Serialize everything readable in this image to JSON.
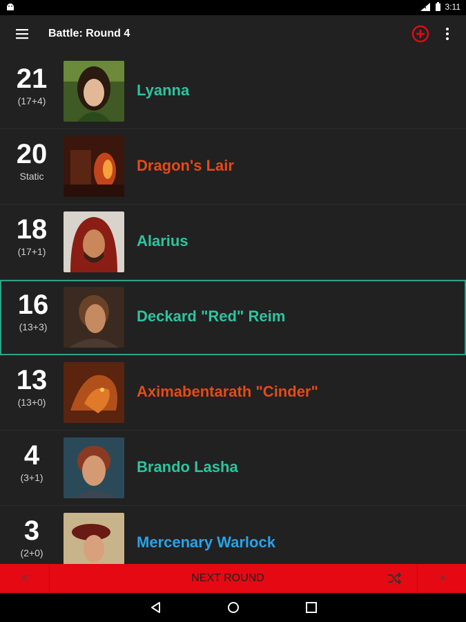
{
  "status_bar": {
    "time": "3:11"
  },
  "app_bar": {
    "title": "Battle: Round 4"
  },
  "colors": {
    "player": "#2ec4a0",
    "enemy": "#e64a19",
    "ally": "#29a3e8",
    "accent_red": "#e50914",
    "active_border": "#2ea38a"
  },
  "combatants": [
    {
      "initiative": "21",
      "detail": "(17+4)",
      "name": "Lyanna",
      "type": "player"
    },
    {
      "initiative": "20",
      "detail": "Static",
      "name": "Dragon's Lair",
      "type": "enemy"
    },
    {
      "initiative": "18",
      "detail": "(17+1)",
      "name": "Alarius",
      "type": "player"
    },
    {
      "initiative": "16",
      "detail": "(13+3)",
      "name": "Deckard \"Red\" Reim",
      "type": "player",
      "active": true
    },
    {
      "initiative": "13",
      "detail": "(13+0)",
      "name": "Aximabentarath \"Cinder\"",
      "type": "enemy"
    },
    {
      "initiative": "4",
      "detail": "(3+1)",
      "name": "Brando Lasha",
      "type": "player"
    },
    {
      "initiative": "3",
      "detail": "(2+0)",
      "name": "Mercenary Warlock",
      "type": "ally"
    }
  ],
  "bottom_bar": {
    "prev_label": "<",
    "next_round_label": "NEXT ROUND",
    "next_label": ">",
    "shuffle_icon": "shuffle-icon"
  },
  "icons": {
    "menu": "hamburger-icon",
    "add": "add-circle-icon",
    "more": "more-vert-icon",
    "back": "back-icon",
    "home": "home-icon",
    "recents": "recents-icon"
  }
}
